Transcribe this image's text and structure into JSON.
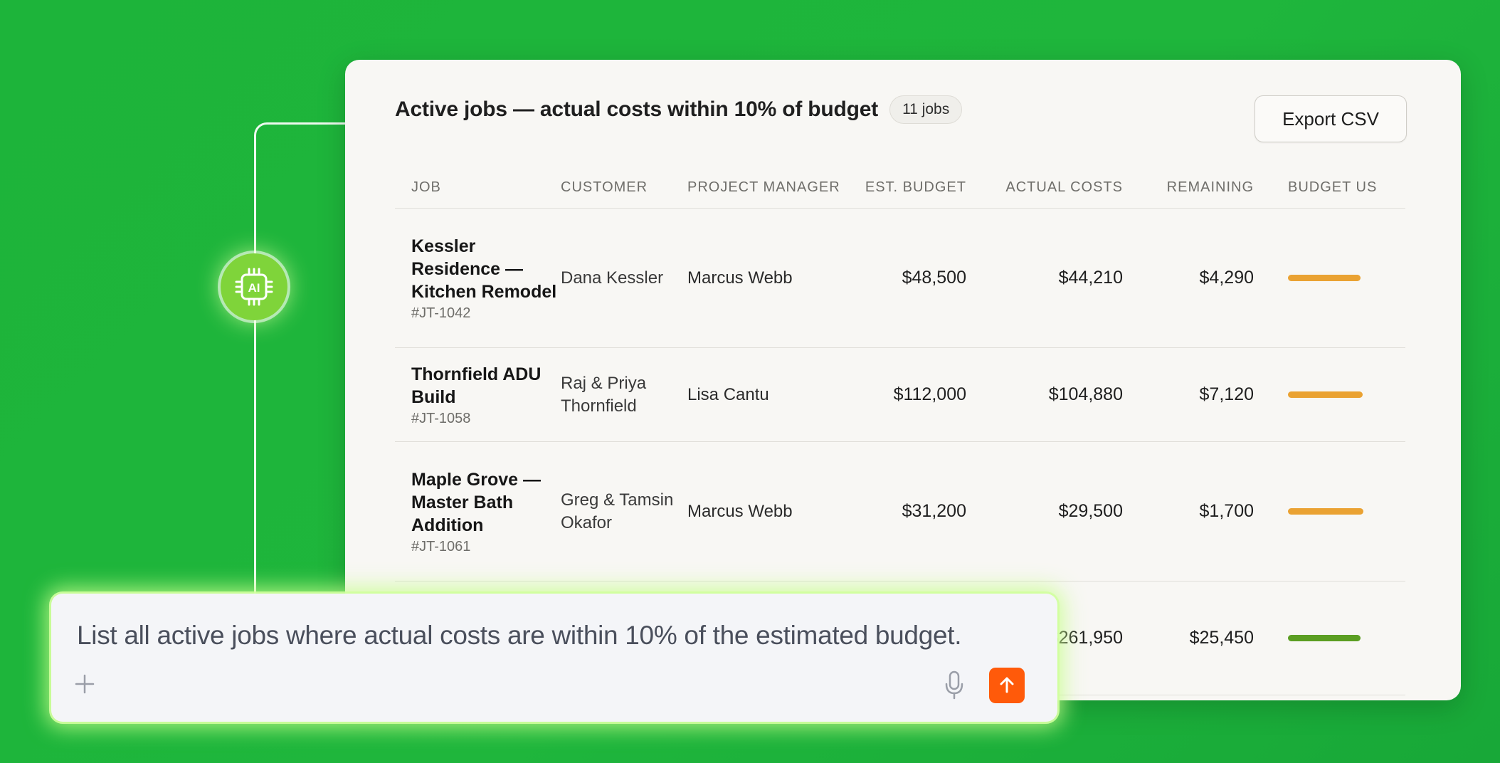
{
  "panel": {
    "title": "Active jobs — actual costs within 10% of budget",
    "count": "11 jobs",
    "export_label": "Export CSV"
  },
  "ai_badge": {
    "label": "AI"
  },
  "table": {
    "columns": [
      "JOB",
      "CUSTOMER",
      "PROJECT MANAGER",
      "EST. BUDGET",
      "ACTUAL COSTS",
      "REMAINING",
      "BUDGET US"
    ],
    "rows": [
      {
        "job": "Kessler Residence — Kitchen Remodel",
        "id": "#JT-1042",
        "customer": "Dana Kessler",
        "pm": "Marcus Webb",
        "budget": "$48,500",
        "actual": "$44,210",
        "remaining": "$4,290",
        "usage_fraction": 0.91,
        "bar_color": "#eaa232"
      },
      {
        "job": "Thornfield ADU Build",
        "id": "#JT-1058",
        "customer": "Raj & Priya Thornfield",
        "pm": "Lisa Cantu",
        "budget": "$112,000",
        "actual": "$104,880",
        "remaining": "$7,120",
        "usage_fraction": 0.94,
        "bar_color": "#eaa232"
      },
      {
        "job": "Maple Grove — Master Bath Addition",
        "id": "#JT-1061",
        "customer": "Greg & Tamsin Okafor",
        "pm": "Marcus Webb",
        "budget": "$31,200",
        "actual": "$29,500",
        "remaining": "$1,700",
        "usage_fraction": 0.95,
        "bar_color": "#eaa232"
      },
      {
        "job": "",
        "id": "",
        "customer": "",
        "pm": "",
        "budget": "",
        "actual": "$261,950",
        "remaining": "$25,450",
        "usage_fraction": 0.91,
        "bar_color": "#5b9e22"
      }
    ]
  },
  "prompt": {
    "text": "List all active jobs where actual costs are within 10% of the estimated budget."
  },
  "colors": {
    "background": "#1db43a",
    "send_button": "#ff5a0a",
    "ai_badge": "#7fd43a"
  }
}
